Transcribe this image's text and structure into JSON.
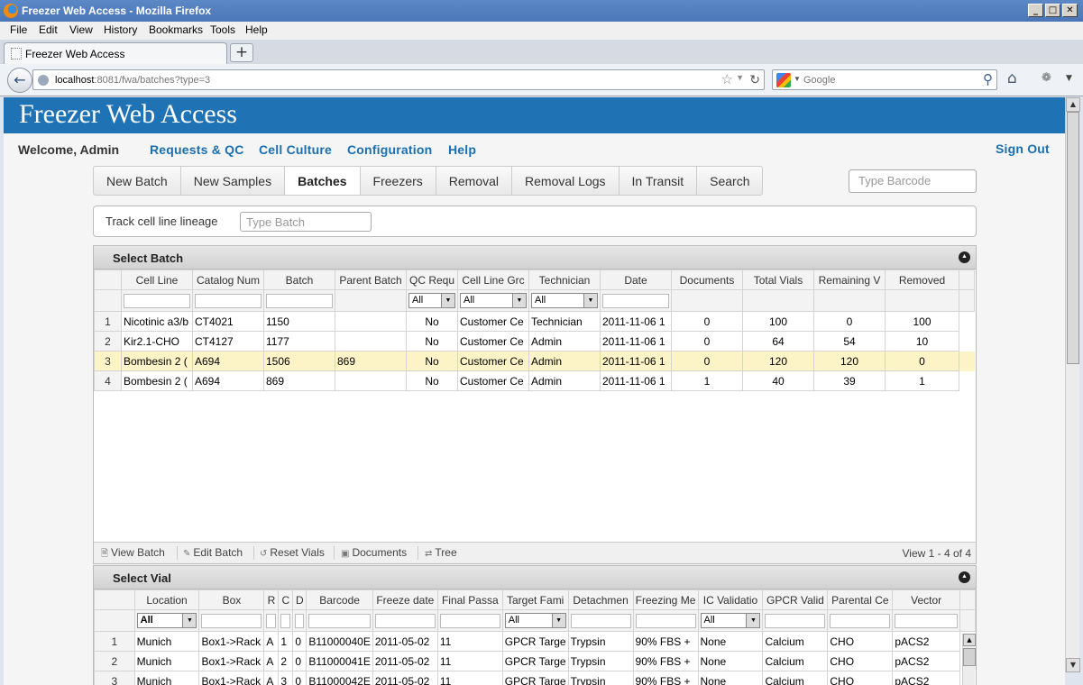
{
  "window": {
    "title": "Freezer Web Access - Mozilla Firefox",
    "min": "_",
    "max": "□",
    "close": "✕"
  },
  "menu": [
    "File",
    "Edit",
    "View",
    "History",
    "Bookmarks",
    "Tools",
    "Help"
  ],
  "tab": {
    "title": "Freezer Web Access",
    "new_tab": "+"
  },
  "address": {
    "host": "localhost",
    "path": ":8081/fwa/batches?type=3"
  },
  "search": {
    "placeholder": "Google"
  },
  "app": {
    "title": "Freezer Web Access",
    "welcome": "Welcome, Admin",
    "top_links": [
      "Requests & QC",
      "Cell Culture",
      "Configuration",
      "Help"
    ],
    "sign_out": "Sign Out",
    "main_nav": [
      "New Batch",
      "New Samples",
      "Batches",
      "Freezers",
      "Removal",
      "Removal Logs",
      "In Transit",
      "Search"
    ],
    "active_nav": "Batches",
    "barcode_placeholder": "Type Barcode",
    "lineage_label": "Track cell line lineage",
    "lineage_placeholder": "Type Batch"
  },
  "batch_panel": {
    "title": "Select Batch",
    "columns": [
      "Cell Line",
      "Catalog Num",
      "Batch",
      "Parent Batch",
      "QC Requ",
      "Cell Line Grc",
      "Technician",
      "Date",
      "Documents",
      "Total Vials",
      "Remaining V",
      "Removed"
    ],
    "filters": {
      "qc": "All",
      "group": "All",
      "technician": "All"
    },
    "rows": [
      [
        "1",
        "Nicotinic a3/b",
        "CT4021",
        "1150",
        "",
        "No",
        "Customer Ce",
        "Technician",
        "2011-11-06 1",
        "0",
        "100",
        "0",
        "100"
      ],
      [
        "2",
        "Kir2.1-CHO",
        "CT4127",
        "1177",
        "",
        "No",
        "Customer Ce",
        "Admin",
        "2011-11-06 1",
        "0",
        "64",
        "54",
        "10"
      ],
      [
        "3",
        "Bombesin 2 (",
        "A694",
        "1506",
        "869",
        "No",
        "Customer Ce",
        "Admin",
        "2011-11-06 1",
        "0",
        "120",
        "120",
        "0"
      ],
      [
        "4",
        "Bombesin 2 (",
        "A694",
        "869",
        "",
        "No",
        "Customer Ce",
        "Admin",
        "2011-11-06 1",
        "1",
        "40",
        "39",
        "1"
      ]
    ],
    "selected_row": 3,
    "pager_buttons": [
      "View Batch",
      "Edit Batch",
      "Reset Vials",
      "Documents",
      "Tree"
    ],
    "pager_info": "View 1 - 4 of 4"
  },
  "vial_panel": {
    "title": "Select Vial",
    "columns": [
      "Location",
      "Box",
      "R",
      "C",
      "D",
      "Barcode",
      "Freeze date",
      "Final Passa",
      "Target Fami",
      "Detachmen",
      "Freezing Me",
      "IC Validatio",
      "GPCR Valid",
      "Parental Ce",
      "Vector"
    ],
    "filters": {
      "location": "All",
      "target": "All",
      "ic": "All"
    },
    "rows": [
      [
        "1",
        "Munich",
        "Box1->Rack",
        "A",
        "1",
        "0",
        "B11000040E",
        "2011-05-02",
        "11",
        "GPCR Targe",
        "Trypsin",
        "90% FBS +",
        "None",
        "Calcium",
        "CHO",
        "pACS2"
      ],
      [
        "2",
        "Munich",
        "Box1->Rack",
        "A",
        "2",
        "0",
        "B11000041E",
        "2011-05-02",
        "11",
        "GPCR Targe",
        "Trypsin",
        "90% FBS +",
        "None",
        "Calcium",
        "CHO",
        "pACS2"
      ],
      [
        "3",
        "Munich",
        "Box1->Rack",
        "A",
        "3",
        "0",
        "B11000042E",
        "2011-05-02",
        "11",
        "GPCR Targe",
        "Trypsin",
        "90% FBS +",
        "None",
        "Calcium",
        "CHO",
        "pACS2"
      ]
    ]
  },
  "icons": [
    "firefox-icon",
    "back-arrow-icon",
    "globe-icon",
    "bookmark-star-icon",
    "reload-icon",
    "google-icon",
    "search-icon",
    "home-icon",
    "addon-icon",
    "collapse-icon"
  ]
}
